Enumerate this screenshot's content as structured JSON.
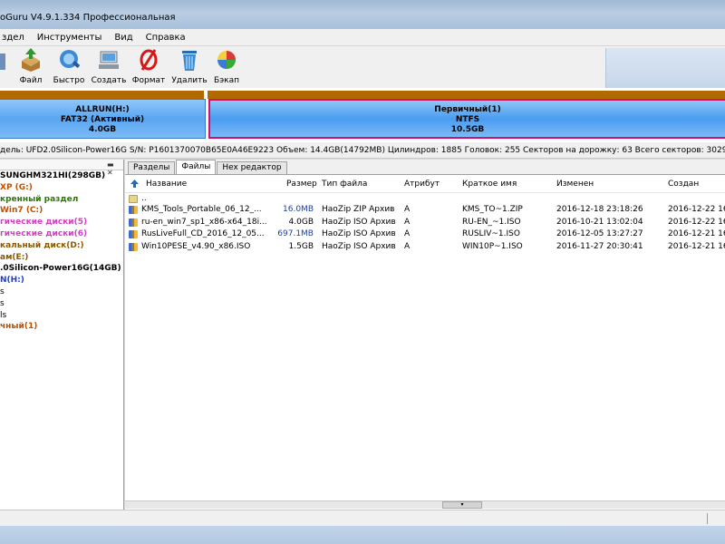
{
  "window": {
    "title": "oGuru V4.9.1.334 Профессиональная"
  },
  "menu": [
    "здел",
    "Инструменты",
    "Вид",
    "Справка"
  ],
  "toolbar": {
    "buttons": [
      {
        "label": "Файл",
        "icon": "file-icon"
      },
      {
        "label": "Быстро",
        "icon": "quick-icon"
      },
      {
        "label": "Создать",
        "icon": "create-icon"
      },
      {
        "label": "Формат",
        "icon": "format-icon"
      },
      {
        "label": "Удалить",
        "icon": "delete-icon"
      },
      {
        "label": "Бэкап",
        "icon": "backup-icon"
      }
    ]
  },
  "diskmap": {
    "part1": {
      "name": "ALLRUN(H:)",
      "fs": "FAT32 (Активный)",
      "size": "4.0GB"
    },
    "part2": {
      "name": "Первичный(1)",
      "fs": "NTFS",
      "size": "10.5GB"
    }
  },
  "diskinfo": "дель: UFD2.0Silicon-Power16G  S/N: P1601370070B65E0A46E9223  Объем: 14.4GB(14792MB)  Цилиндров: 1885  Головок: 255  Секторов на дорожку: 63  Всего секторов: 30294016",
  "tree": [
    {
      "text": "SUNGHM321HI(298GB)",
      "color": "#000000"
    },
    {
      "text": "XP (G:)",
      "color": "#c05000"
    },
    {
      "text": "кренный раздел",
      "color": "#2a7a00"
    },
    {
      "text": "Win7 (C:)",
      "color": "#c05000"
    },
    {
      "text": "гические диски(5)",
      "color": "#d040c0"
    },
    {
      "text": "гические диски(6)",
      "color": "#d040c0"
    },
    {
      "text": "кальный диск(D:)",
      "color": "#8a5a00"
    },
    {
      "text": "ам(E:)",
      "color": "#8a5a00"
    },
    {
      "text": ".0Silicon-Power16G(14GB)",
      "color": "#000000"
    },
    {
      "text": "N(H:)",
      "color": "#1a3fd0"
    },
    {
      "text": "s",
      "color": "#000000"
    },
    {
      "text": "s",
      "color": "#000000"
    },
    {
      "text": "ls",
      "color": "#000000"
    },
    {
      "text": "чный(1)",
      "color": "#c05000"
    }
  ],
  "tabs": [
    {
      "label": "Разделы",
      "active": false
    },
    {
      "label": "Файлы",
      "active": true
    },
    {
      "label": "Hex редактор",
      "active": false
    }
  ],
  "columns": [
    "Название",
    "Размер",
    "Тип файла",
    "Атрибут",
    "Краткое имя",
    "Изменен",
    "Создан"
  ],
  "parent_row": "..",
  "files": [
    {
      "name": "KMS_Tools_Portable_06_12_...",
      "size": "16.0MB",
      "type": "HaoZip ZIP Архив",
      "attr": "A",
      "short": "KMS_TO~1.ZIP",
      "modified": "2016-12-18 23:18:26",
      "created": "2016-12-22 16:4",
      "icon_color": "#3a6ad0"
    },
    {
      "name": "ru-en_win7_sp1_x86-x64_18i...",
      "size": "4.0GB",
      "type": "HaoZip ISO Архив",
      "attr": "A",
      "short": "RU-EN_~1.ISO",
      "modified": "2016-10-21 13:02:04",
      "created": "2016-12-22 16:4",
      "icon_color": "#3a6ad0"
    },
    {
      "name": "RusLiveFull_CD_2016_12_05...",
      "size": "697.1MB",
      "type": "HaoZip ISO Архив",
      "attr": "A",
      "short": "RUSLIV~1.ISO",
      "modified": "2016-12-05 13:27:27",
      "created": "2016-12-21 16:2",
      "icon_color": "#3a6ad0"
    },
    {
      "name": "Win10PESE_v4.90_x86.ISO",
      "size": "1.5GB",
      "type": "HaoZip ISO Архив",
      "attr": "A",
      "short": "WIN10P~1.ISO",
      "modified": "2016-11-27 20:30:41",
      "created": "2016-12-21 16:2",
      "icon_color": "#3a6ad0"
    }
  ],
  "colors": {
    "disk_bar": "#b06a00",
    "part1_fill": "#5aa6f2",
    "part2_fill": "#4a9cf0",
    "part2_border": "#d0106a"
  }
}
